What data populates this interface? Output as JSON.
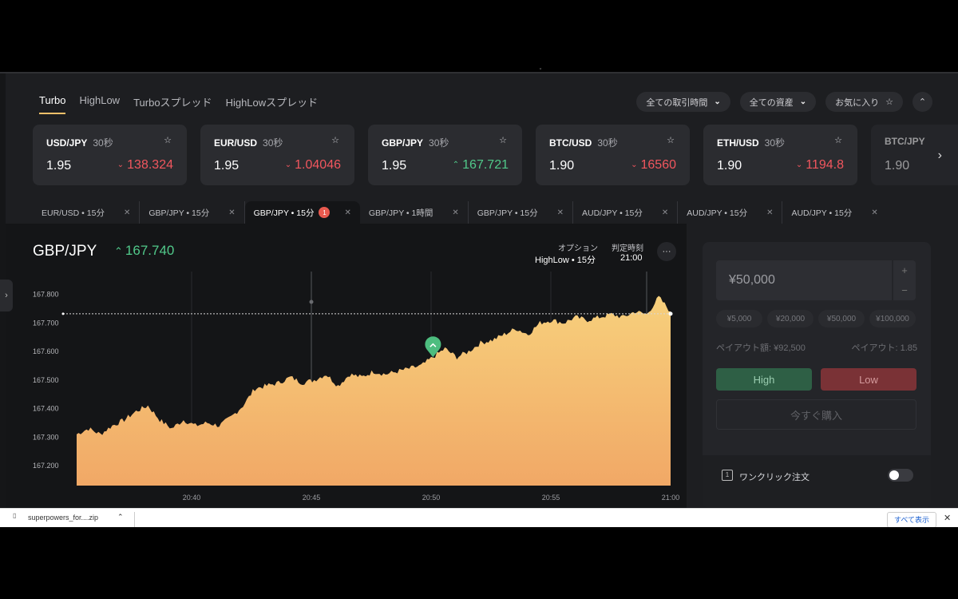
{
  "type_tabs": [
    {
      "label": "Turbo",
      "active": true
    },
    {
      "label": "HighLow",
      "active": false
    },
    {
      "label": "Turboスプレッド",
      "active": false
    },
    {
      "label": "HighLowスプレッド",
      "active": false
    }
  ],
  "filters": {
    "time": "全ての取引時間",
    "assets": "全ての資産",
    "favorites": "お気に入り"
  },
  "asset_cards": [
    {
      "symbol": "USD/JPY",
      "duration": "30秒",
      "payout": "1.95",
      "price": "138.324",
      "direction": "down"
    },
    {
      "symbol": "EUR/USD",
      "duration": "30秒",
      "payout": "1.95",
      "price": "1.04046",
      "direction": "down"
    },
    {
      "symbol": "GBP/JPY",
      "duration": "30秒",
      "payout": "1.95",
      "price": "167.721",
      "direction": "up"
    },
    {
      "symbol": "BTC/USD",
      "duration": "30秒",
      "payout": "1.90",
      "price": "16560",
      "direction": "down"
    },
    {
      "symbol": "ETH/USD",
      "duration": "30秒",
      "payout": "1.90",
      "price": "1194.8",
      "direction": "down"
    },
    {
      "symbol": "BTC/JPY",
      "duration": "",
      "payout": "1.90",
      "price": "",
      "direction": ""
    }
  ],
  "chart_tabs": [
    {
      "label": "EUR/USD • 15分",
      "active": false,
      "badge": ""
    },
    {
      "label": "GBP/JPY • 15分",
      "active": false,
      "badge": ""
    },
    {
      "label": "GBP/JPY • 15分",
      "active": true,
      "badge": "1"
    },
    {
      "label": "GBP/JPY • 1時間",
      "active": false,
      "badge": ""
    },
    {
      "label": "GBP/JPY • 15分",
      "active": false,
      "badge": ""
    },
    {
      "label": "AUD/JPY • 15分",
      "active": false,
      "badge": ""
    },
    {
      "label": "AUD/JPY • 15分",
      "active": false,
      "badge": ""
    },
    {
      "label": "AUD/JPY • 15分",
      "active": false,
      "badge": ""
    }
  ],
  "main": {
    "pair": "GBP/JPY",
    "price": "167.740",
    "option_label": "オプション",
    "option_value": "HighLow • 15分",
    "expiry_label": "判定時刻",
    "expiry_value": "21:00"
  },
  "chart_data": {
    "type": "area",
    "y_ticks": [
      "167.800",
      "167.700",
      "167.600",
      "167.500",
      "167.400",
      "167.300",
      "167.200"
    ],
    "ylim": [
      167.13,
      167.88
    ],
    "x": [
      0,
      1,
      2,
      3,
      4,
      5,
      6,
      7,
      8,
      9,
      10,
      11,
      12,
      13,
      14,
      15,
      16,
      17,
      18,
      19,
      20,
      21,
      22,
      23,
      24,
      25,
      26,
      27,
      28,
      29,
      30,
      31,
      32,
      33,
      34,
      35,
      36,
      37,
      38,
      39,
      40,
      41,
      42,
      43,
      44,
      45,
      46,
      47,
      48,
      49,
      50
    ],
    "values": [
      167.31,
      167.33,
      167.31,
      167.34,
      167.36,
      167.39,
      167.41,
      167.36,
      167.33,
      167.36,
      167.34,
      167.35,
      167.34,
      167.37,
      167.41,
      167.47,
      167.48,
      167.49,
      167.51,
      167.49,
      167.5,
      167.52,
      167.48,
      167.52,
      167.51,
      167.53,
      167.52,
      167.53,
      167.54,
      167.55,
      167.58,
      167.61,
      167.58,
      167.6,
      167.63,
      167.64,
      167.66,
      167.68,
      167.66,
      167.7,
      167.71,
      167.7,
      167.72,
      167.71,
      167.72,
      167.73,
      167.72,
      167.74,
      167.73,
      167.79,
      167.74
    ],
    "reference_line": 167.732,
    "marker_index": 30,
    "x_tick_labels": [
      "20:40",
      "20:45",
      "20:50",
      "20:55",
      "21:00"
    ],
    "colors": {
      "area_top": "#f7d07c",
      "area_bottom": "#f1a866",
      "marker": "#4dbd7f"
    }
  },
  "trade": {
    "amount": "¥50,000",
    "plus": "+",
    "minus": "−",
    "presets": [
      "¥5,000",
      "¥20,000",
      "¥50,000",
      "¥100,000"
    ],
    "payout_amount": "ペイアウト額: ¥92,500",
    "payout_rate": "ペイアウト: 1.85",
    "high": "High",
    "low": "Low",
    "buy": "今すぐ購入",
    "one_click": "ワンクリック注文"
  },
  "download_bar": {
    "file": "superpowers_for....zip",
    "show_all": "すべて表示"
  }
}
